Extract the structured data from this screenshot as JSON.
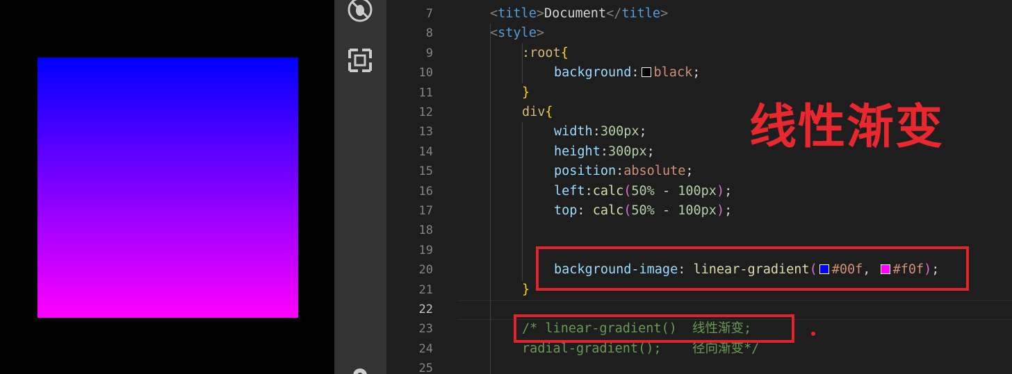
{
  "preview": {
    "background": "#000000",
    "gradient_from": "#0000ff",
    "gradient_to": "#ff00ff"
  },
  "activity_bar": {
    "icons": [
      "no-bugs-icon",
      "remote-explorer-icon",
      "settings-gear-icon"
    ]
  },
  "editor": {
    "current_line": 22,
    "lines": [
      {
        "n": "7",
        "indent": 1,
        "tokens": [
          [
            "c-punct",
            "<"
          ],
          [
            "c-tag",
            "title"
          ],
          [
            "c-punct",
            ">"
          ],
          [
            "c-text",
            "Document"
          ],
          [
            "c-punct",
            "</"
          ],
          [
            "c-tag",
            "title"
          ],
          [
            "c-punct",
            ">"
          ]
        ]
      },
      {
        "n": "8",
        "indent": 1,
        "tokens": [
          [
            "c-punct",
            "<"
          ],
          [
            "c-tag",
            "style"
          ],
          [
            "c-punct",
            ">"
          ]
        ]
      },
      {
        "n": "9",
        "indent": 2,
        "tokens": [
          [
            "c-sel",
            ":root"
          ],
          [
            "c-brace",
            "{"
          ]
        ]
      },
      {
        "n": "10",
        "indent": 3,
        "tokens": [
          [
            "c-prop",
            "background"
          ],
          [
            "c-text",
            ":"
          ],
          [
            "swatch",
            "#000000"
          ],
          [
            "c-val",
            "black"
          ],
          [
            "c-text",
            ";"
          ]
        ]
      },
      {
        "n": "11",
        "indent": 2,
        "tokens": [
          [
            "c-brace",
            "}"
          ]
        ]
      },
      {
        "n": "12",
        "indent": 2,
        "tokens": [
          [
            "c-sel",
            "div"
          ],
          [
            "c-brace",
            "{"
          ]
        ]
      },
      {
        "n": "13",
        "indent": 3,
        "tokens": [
          [
            "c-prop",
            "width"
          ],
          [
            "c-text",
            ":"
          ],
          [
            "c-num",
            "300px"
          ],
          [
            "c-text",
            ";"
          ]
        ]
      },
      {
        "n": "14",
        "indent": 3,
        "tokens": [
          [
            "c-prop",
            "height"
          ],
          [
            "c-text",
            ":"
          ],
          [
            "c-num",
            "300px"
          ],
          [
            "c-text",
            ";"
          ]
        ]
      },
      {
        "n": "15",
        "indent": 3,
        "tokens": [
          [
            "c-prop",
            "position"
          ],
          [
            "c-text",
            ":"
          ],
          [
            "c-val",
            "absolute"
          ],
          [
            "c-text",
            ";"
          ]
        ]
      },
      {
        "n": "16",
        "indent": 3,
        "tokens": [
          [
            "c-prop",
            "left"
          ],
          [
            "c-text",
            ":"
          ],
          [
            "c-fn",
            "calc"
          ],
          [
            "c-paren",
            "("
          ],
          [
            "c-num",
            "50%"
          ],
          [
            "c-text",
            " - "
          ],
          [
            "c-num",
            "100px"
          ],
          [
            "c-paren",
            ")"
          ],
          [
            "c-text",
            ";"
          ]
        ]
      },
      {
        "n": "17",
        "indent": 3,
        "tokens": [
          [
            "c-prop",
            "top"
          ],
          [
            "c-text",
            ": "
          ],
          [
            "c-fn",
            "calc"
          ],
          [
            "c-paren",
            "("
          ],
          [
            "c-num",
            "50%"
          ],
          [
            "c-text",
            " - "
          ],
          [
            "c-num",
            "100px"
          ],
          [
            "c-paren",
            ")"
          ],
          [
            "c-text",
            ";"
          ]
        ]
      },
      {
        "n": "18",
        "indent": 3,
        "tokens": []
      },
      {
        "n": "19",
        "indent": 3,
        "tokens": []
      },
      {
        "n": "20",
        "indent": 3,
        "tokens": [
          [
            "c-prop",
            "background-image"
          ],
          [
            "c-text",
            ": "
          ],
          [
            "c-fn",
            "linear-gradient"
          ],
          [
            "c-paren",
            "("
          ],
          [
            "swatch",
            "#0000ff"
          ],
          [
            "c-val",
            "#00f"
          ],
          [
            "c-text",
            ", "
          ],
          [
            "swatch",
            "#ff00ff"
          ],
          [
            "c-val",
            "#f0f"
          ],
          [
            "c-paren",
            ")"
          ],
          [
            "c-text",
            ";"
          ]
        ]
      },
      {
        "n": "21",
        "indent": 2,
        "tokens": [
          [
            "c-brace",
            "}"
          ]
        ]
      },
      {
        "n": "22",
        "indent": 1,
        "tokens": []
      },
      {
        "n": "23",
        "indent": 2,
        "tokens": [
          [
            "c-comment",
            "/* linear-gradient()  线性渐变;"
          ]
        ]
      },
      {
        "n": "24",
        "indent": 2,
        "tokens": [
          [
            "c-comment",
            "radial-gradient();    径向渐变*/"
          ]
        ]
      },
      {
        "n": "25",
        "indent": 2,
        "tokens": []
      }
    ]
  },
  "annotation": {
    "title": "线性渐变",
    "color": "#e0242b"
  }
}
